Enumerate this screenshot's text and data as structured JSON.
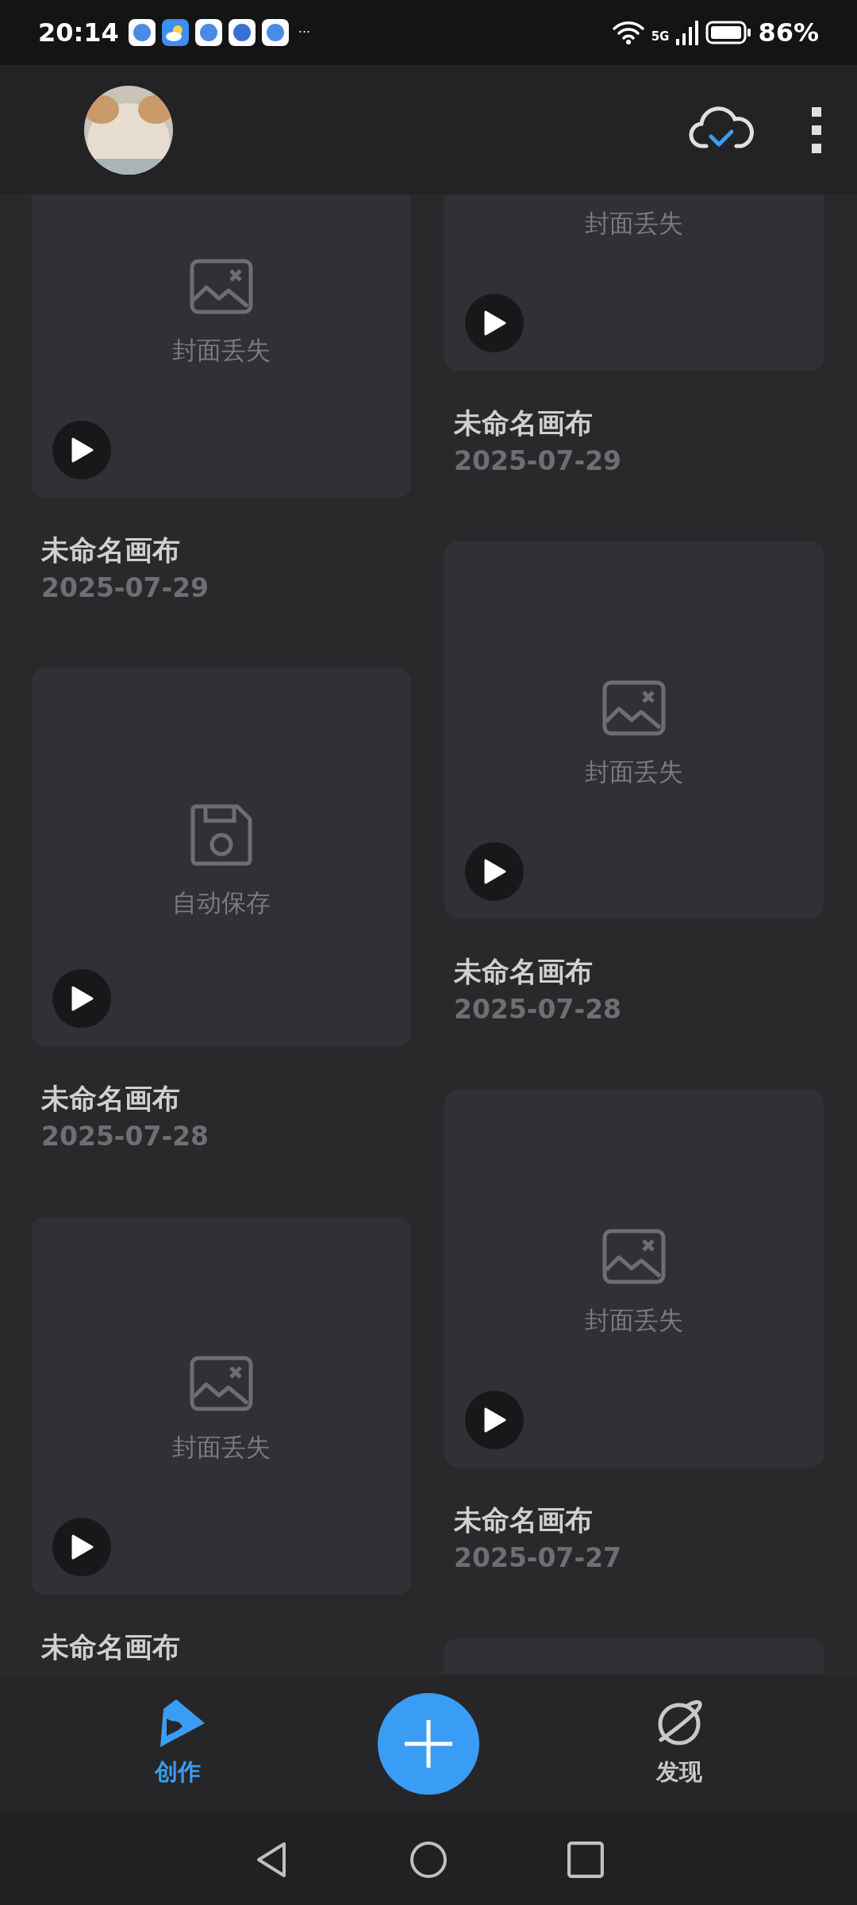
{
  "status_bar": {
    "time": "20:14",
    "more": "···",
    "network": "5G",
    "battery": "86%"
  },
  "columns": [
    [
      {
        "kind": "missing",
        "label": "封面丢失",
        "title": "未命名画布",
        "date": "2025-07-29"
      },
      {
        "kind": "autosave",
        "label": "自动保存",
        "title": "未命名画布",
        "date": "2025-07-28"
      },
      {
        "kind": "missing",
        "label": "封面丢失",
        "title": "未命名画布"
      }
    ],
    [
      {
        "kind": "missing",
        "icon_scrolled_off": true,
        "label": "封面丢失",
        "title": "未命名画布",
        "date": "2025-07-29"
      },
      {
        "kind": "missing",
        "label": "封面丢失",
        "title": "未命名画布",
        "date": "2025-07-28"
      },
      {
        "kind": "missing",
        "label": "封面丢失",
        "title": "未命名画布",
        "date": "2025-07-27"
      },
      {
        "kind": "empty"
      }
    ]
  ],
  "bottom_nav": {
    "tabs": [
      {
        "kind": "create",
        "label": "创作",
        "selected": true
      },
      {
        "kind": "add"
      },
      {
        "kind": "discover",
        "label": "发现",
        "selected": false
      }
    ]
  }
}
